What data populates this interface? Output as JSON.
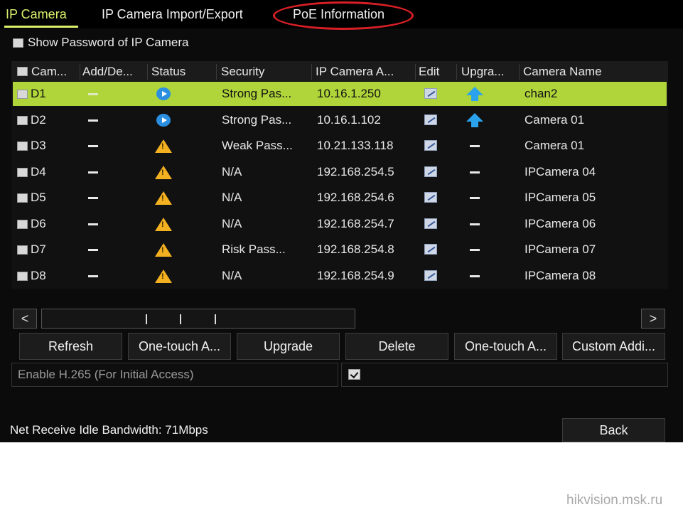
{
  "tabs": [
    {
      "label": "IP Camera",
      "active": true
    },
    {
      "label": "IP Camera Import/Export",
      "active": false
    },
    {
      "label": "PoE Information",
      "active": false
    }
  ],
  "show_password_label": "Show Password of IP Camera",
  "table": {
    "columns": [
      "Cam...",
      "Add/De...",
      "Status",
      "Security",
      "IP Camera A...",
      "Edit",
      "Upgra...",
      "Camera Name"
    ],
    "rows": [
      {
        "cam": "D1",
        "status": "play-icon",
        "security": "Strong Pas...",
        "ip": "10.16.1.250",
        "upgrade": "upgrade-icon",
        "name": "chan2",
        "selected": true
      },
      {
        "cam": "D2",
        "status": "play-icon",
        "security": "Strong Pas...",
        "ip": "10.16.1.102",
        "upgrade": "upgrade-icon",
        "name": "Camera 01",
        "selected": false
      },
      {
        "cam": "D3",
        "status": "warning-icon",
        "security": "Weak Pass...",
        "ip": "10.21.133.118",
        "upgrade": "dash",
        "name": "Camera 01",
        "selected": false
      },
      {
        "cam": "D4",
        "status": "warning-icon",
        "security": "N/A",
        "ip": "192.168.254.5",
        "upgrade": "dash",
        "name": "IPCamera 04",
        "selected": false
      },
      {
        "cam": "D5",
        "status": "warning-icon",
        "security": "N/A",
        "ip": "192.168.254.6",
        "upgrade": "dash",
        "name": "IPCamera 05",
        "selected": false
      },
      {
        "cam": "D6",
        "status": "warning-icon",
        "security": "N/A",
        "ip": "192.168.254.7",
        "upgrade": "dash",
        "name": "IPCamera 06",
        "selected": false
      },
      {
        "cam": "D7",
        "status": "warning-icon",
        "security": "Risk Pass...",
        "ip": "192.168.254.8",
        "upgrade": "dash",
        "name": "IPCamera 07",
        "selected": false
      },
      {
        "cam": "D8",
        "status": "warning-icon",
        "security": "N/A",
        "ip": "192.168.254.9",
        "upgrade": "dash",
        "name": "IPCamera 08",
        "selected": false
      }
    ]
  },
  "scrollbar": {
    "left": "<",
    "right": ">"
  },
  "buttons": [
    "Refresh",
    "One-touch A...",
    "Upgrade",
    "Delete",
    "One-touch A...",
    "Custom Addi..."
  ],
  "h265_label": "Enable H.265 (For Initial Access)",
  "h265_checked": true,
  "bandwidth": "Net Receive Idle Bandwidth: 71Mbps",
  "back_label": "Back",
  "watermark": "hikvision.msk.ru",
  "colors": {
    "accent": "#d9f06a",
    "selected_row": "#b0d53a",
    "annotation": "#d81f26",
    "background": "#0b0b0b"
  }
}
